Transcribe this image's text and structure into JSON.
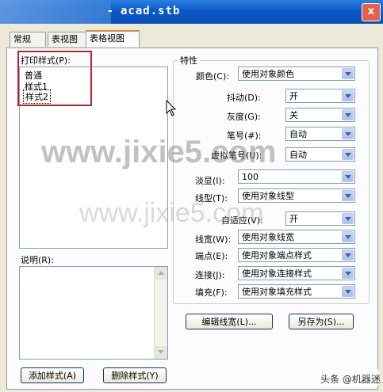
{
  "window": {
    "title": "acad.stb",
    "title_prefix": "-",
    "close_glyph": "x"
  },
  "tabs": [
    {
      "label": "常规"
    },
    {
      "label": "表视图"
    },
    {
      "label": "表格视图"
    }
  ],
  "styles_panel": {
    "label": "打印样式(P):",
    "items": [
      "普通",
      "样式1",
      "样式2"
    ],
    "selected_index": 2
  },
  "description": {
    "label": "说明(R):",
    "value": ""
  },
  "properties": {
    "group_title": "特性",
    "rows": [
      {
        "label": "颜色(C):",
        "value": "使用对象颜色"
      },
      {
        "label": "抖动(D):",
        "value": "开"
      },
      {
        "label": "灰度(G):",
        "value": "关"
      },
      {
        "label": "笔号(#):",
        "value": "自动"
      },
      {
        "label": "虚拟笔号(U):",
        "value": "自动"
      },
      {
        "label": "淡显(I):",
        "value": "100"
      },
      {
        "label": "线型(T):",
        "value": "使用对象线型"
      },
      {
        "label": "自适应(V):",
        "value": "开"
      },
      {
        "label": "线宽(W):",
        "value": "使用对象线宽"
      },
      {
        "label": "端点(E):",
        "value": "使用对象端点样式"
      },
      {
        "label": "连接(J):",
        "value": "使用对象连接样式"
      },
      {
        "label": "填充(F):",
        "value": "使用对象填充样式"
      }
    ]
  },
  "buttons": {
    "edit_lineweights": "编辑线宽(L)...",
    "save_as": "另存为(S)...",
    "add_style": "添加样式(A)",
    "delete_style": "删除样式(Y)"
  },
  "watermarks": [
    "www.jixie5.com",
    "www.jixie5.com"
  ],
  "credit": "头条 @机器迷",
  "colors": {
    "title_bar": "#0b59c8",
    "highlight_box": "#b8232e",
    "dialog_bg": "#ece9d8"
  }
}
